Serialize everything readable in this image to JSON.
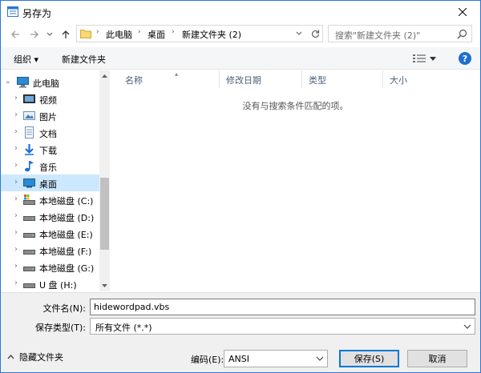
{
  "window": {
    "title": "另存为"
  },
  "address": {
    "crumbs": [
      "此电脑",
      "桌面",
      "新建文件夹 (2)"
    ]
  },
  "search": {
    "placeholder": "搜索\"新建文件夹 (2)\""
  },
  "toolbar": {
    "organize_label": "组织 ▾",
    "new_folder_label": "新建文件夹",
    "help_label": "?"
  },
  "nav_tree": {
    "root_label": "此电脑",
    "items": [
      {
        "label": "视频",
        "icon": "video-folder-icon"
      },
      {
        "label": "图片",
        "icon": "pictures-folder-icon"
      },
      {
        "label": "文档",
        "icon": "documents-folder-icon"
      },
      {
        "label": "下载",
        "icon": "downloads-folder-icon"
      },
      {
        "label": "音乐",
        "icon": "music-folder-icon"
      },
      {
        "label": "桌面",
        "icon": "desktop-folder-icon",
        "selected": true
      },
      {
        "label": "本地磁盘 (C:)",
        "icon": "system-drive-icon"
      },
      {
        "label": "本地磁盘 (D:)",
        "icon": "drive-icon"
      },
      {
        "label": "本地磁盘 (E:)",
        "icon": "drive-icon"
      },
      {
        "label": "本地磁盘 (F:)",
        "icon": "drive-icon"
      },
      {
        "label": "本地磁盘 (G:)",
        "icon": "drive-icon"
      },
      {
        "label": "U 盘 (H:)",
        "icon": "usb-drive-icon"
      }
    ]
  },
  "file_list": {
    "columns": [
      "名称",
      "修改日期",
      "类型",
      "大小"
    ],
    "empty_message": "没有与搜索条件匹配的项。"
  },
  "form": {
    "filename_label": "文件名(N):",
    "filename_value": "hidewordpad.vbs",
    "filetype_label": "保存类型(T):",
    "filetype_value": "所有文件  (*.*)",
    "hide_folders_label": "隐藏文件夹",
    "encoding_label": "编码(E):",
    "encoding_value": "ANSI",
    "save_label": "保存(S)",
    "cancel_label": "取消"
  },
  "colors": {
    "accent": "#0078d7",
    "selection": "#cce8ff"
  }
}
